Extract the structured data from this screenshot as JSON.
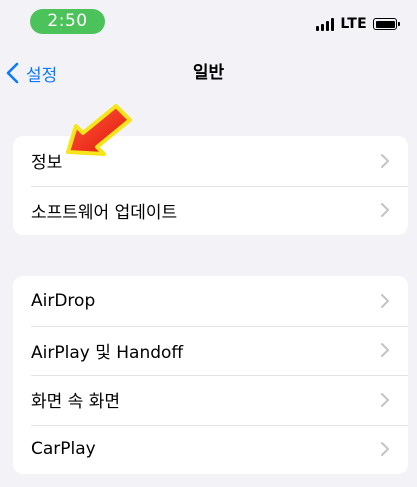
{
  "status_bar": {
    "time": "2:50",
    "network": "LTE",
    "time_pill_color": "#4cc35a"
  },
  "nav": {
    "back_label": "설정",
    "title": "일반",
    "accent_color": "#0a7aff"
  },
  "groups": [
    {
      "items": [
        {
          "label": "정보"
        },
        {
          "label": "소프트웨어 업데이트"
        }
      ]
    },
    {
      "items": [
        {
          "label": "AirDrop"
        },
        {
          "label": "AirPlay 및 Handoff"
        },
        {
          "label": "화면 속 화면"
        },
        {
          "label": "CarPlay"
        }
      ]
    }
  ],
  "annotation": {
    "icon": "red-arrow-icon",
    "color": "#ff2a1a",
    "outline_color": "#f5e51a"
  }
}
